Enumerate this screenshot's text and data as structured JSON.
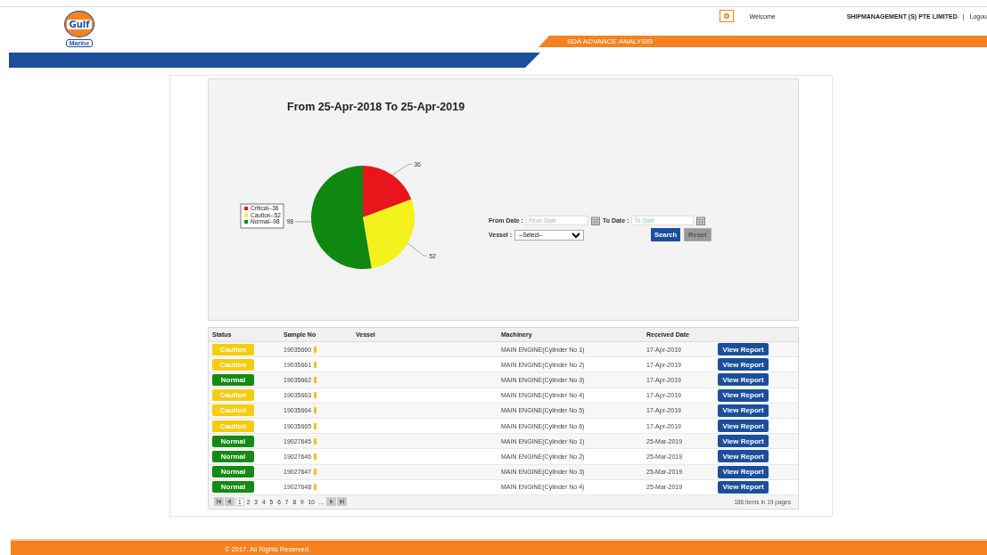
{
  "header": {
    "logo_top": "Gulf",
    "logo_bottom": "Marine",
    "welcome": "Welcome",
    "company": "SHIPMANAGEMENT (S) PTE LIMITED",
    "separator": "|",
    "logout": "Logou",
    "section_title": "SDA ADVANCE ANALYSIS"
  },
  "chart": {
    "heading": "From 25-Apr-2018 To 25-Apr-2019",
    "chart_data": {
      "type": "pie",
      "categories": [
        "Critical--36",
        "Caution--52",
        "Normal--98"
      ],
      "series": [
        {
          "values": [
            36,
            52,
            98
          ]
        }
      ],
      "colors": [
        "#e8161b",
        "#f3f21c",
        "#108810"
      ],
      "legend": "left",
      "data_labels": true
    }
  },
  "filters": {
    "from_label": "From Date :",
    "from_placeholder": "From Date",
    "to_label": "To Date :",
    "to_placeholder": "To Date",
    "vessel_label": "Vessel :",
    "vessel_value": "--Select--",
    "search": "Search",
    "reset": "Reset"
  },
  "table": {
    "columns": [
      "Status",
      "Sample No",
      "Vessel",
      "Machinery",
      "Received Date"
    ],
    "rows": [
      {
        "status": "Caution",
        "kind": "caution",
        "sample_no": "19035660",
        "machinery": "MAIN ENGINE(Cylinder No 1)",
        "received": "17-Apr-2019",
        "action": "View Report"
      },
      {
        "status": "Caution",
        "kind": "caution",
        "sample_no": "19035661",
        "machinery": "MAIN ENGINE(Cylinder No 2)",
        "received": "17-Apr-2019",
        "action": "View Report"
      },
      {
        "status": "Normal",
        "kind": "normal",
        "sample_no": "19035662",
        "machinery": "MAIN ENGINE(Cylinder No 3)",
        "received": "17-Apr-2019",
        "action": "View Report"
      },
      {
        "status": "Caution",
        "kind": "caution",
        "sample_no": "19035663",
        "machinery": "MAIN ENGINE(Cylinder No 4)",
        "received": "17-Apr-2019",
        "action": "View Report"
      },
      {
        "status": "Caution",
        "kind": "caution",
        "sample_no": "19035664",
        "machinery": "MAIN ENGINE(Cylinder No 5)",
        "received": "17-Apr-2019",
        "action": "View Report"
      },
      {
        "status": "Caution",
        "kind": "caution",
        "sample_no": "19035665",
        "machinery": "MAIN ENGINE(Cylinder No 6)",
        "received": "17-Apr-2019",
        "action": "View Report"
      },
      {
        "status": "Normal",
        "kind": "normal",
        "sample_no": "19027645",
        "machinery": "MAIN ENGINE(Cylinder No 1)",
        "received": "25-Mar-2019",
        "action": "View Report"
      },
      {
        "status": "Normal",
        "kind": "normal",
        "sample_no": "19027646",
        "machinery": "MAIN ENGINE(Cylinder No 2)",
        "received": "25-Mar-2019",
        "action": "View Report"
      },
      {
        "status": "Normal",
        "kind": "normal",
        "sample_no": "19027647",
        "machinery": "MAIN ENGINE(Cylinder No 3)",
        "received": "25-Mar-2019",
        "action": "View Report"
      },
      {
        "status": "Normal",
        "kind": "normal",
        "sample_no": "19027648",
        "machinery": "MAIN ENGINE(Cylinder No 4)",
        "received": "25-Mar-2019",
        "action": "View Report"
      }
    ],
    "pages": [
      {
        "label": "1",
        "selected": true
      },
      {
        "label": "2",
        "selected": false
      },
      {
        "label": "3",
        "selected": false
      },
      {
        "label": "4",
        "selected": false
      },
      {
        "label": "5",
        "selected": false
      },
      {
        "label": "6",
        "selected": false
      },
      {
        "label": "7",
        "selected": false
      },
      {
        "label": "8",
        "selected": false
      },
      {
        "label": "9",
        "selected": false
      },
      {
        "label": "10",
        "selected": false
      },
      {
        "label": "...",
        "selected": false
      }
    ],
    "summary": "186 items in 19 pages"
  },
  "footer": {
    "copyright": "© 2017. All Rights Reserved."
  }
}
